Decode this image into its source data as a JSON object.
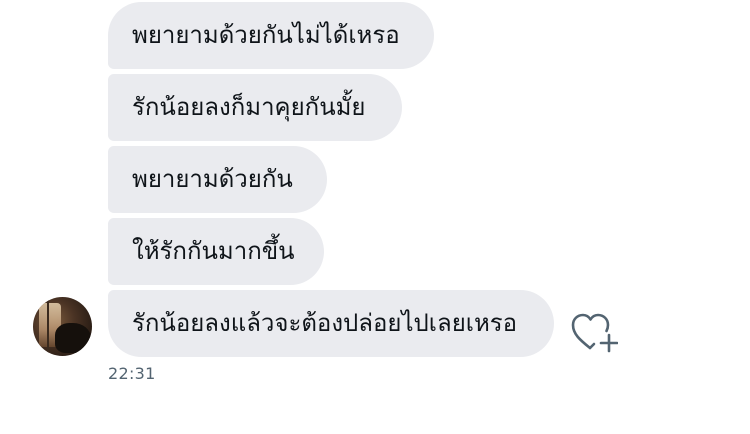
{
  "conversation": {
    "messages": [
      {
        "text": "พยายามด้วยกันไม่ได้เหรอ"
      },
      {
        "text": "รักน้อยลงก็มาคุยกันมั้ย"
      },
      {
        "text": "พยายามด้วยกัน"
      },
      {
        "text": "ให้รักกันมากขึ้น"
      },
      {
        "text": "รักน้อยลงแล้วจะต้องปล่อยไปเลยเหรอ"
      }
    ],
    "timestamp": "22:31",
    "react_icon": "heart-plus-icon",
    "colors": {
      "bubble": "#eaebef",
      "text": "#0f1419",
      "timestamp": "#536471",
      "icon": "#536471"
    }
  }
}
